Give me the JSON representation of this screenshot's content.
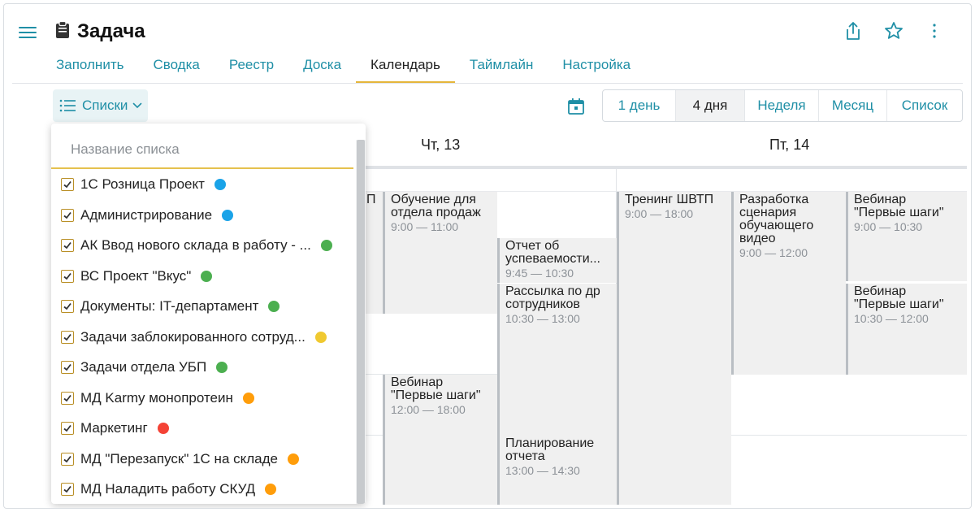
{
  "header": {
    "title": "Задача",
    "icons": [
      "menu-icon",
      "clipboard-icon",
      "share-icon",
      "star-icon",
      "more-vert-icon"
    ]
  },
  "tabs": [
    {
      "label": "Заполнить"
    },
    {
      "label": "Сводка"
    },
    {
      "label": "Реестр"
    },
    {
      "label": "Доска"
    },
    {
      "label": "Календарь",
      "active": true
    },
    {
      "label": "Таймлайн"
    },
    {
      "label": "Настройка"
    }
  ],
  "toolbar": {
    "lists_label": "Списки",
    "view_buttons": [
      "1 день",
      "4 дня",
      "Неделя",
      "Месяц",
      "Список"
    ],
    "active_view": "4 дня"
  },
  "calendar": {
    "days": [
      "Чт, 13",
      "Пт, 14"
    ],
    "events": [
      {
        "title": "П",
        "time": ""
      },
      {
        "title": "Обучение для\nотдела продаж",
        "time": "9:00 — 11:00"
      },
      {
        "title": "Отчет об\nуспеваемости...",
        "time": "9:45 — 10:30"
      },
      {
        "title": "Рассылка по др\nсотрудников",
        "time": "10:30 — 13:00"
      },
      {
        "title": "Вебинар\n\"Первые шаги\"",
        "time": "12:00 — 18:00"
      },
      {
        "title": "Планирование\nотчета",
        "time": "13:00 — 14:30"
      },
      {
        "title": "Тренинг ШВТП",
        "time": "9:00 — 18:00"
      },
      {
        "title": "Разработка\nсценария\nобучающего\nвидео",
        "time": "9:00 — 12:00"
      },
      {
        "title": "Вебинар\n\"Первые шаги\"",
        "time": "9:00 — 10:30"
      },
      {
        "title": "Вебинар\n\"Первые шаги\"",
        "time": "10:30 — 12:00"
      }
    ]
  },
  "lists_dropdown": {
    "search_placeholder": "Название списка",
    "items": [
      {
        "label": "1С Розница Проект",
        "color": "#1aa3e8",
        "checked": true
      },
      {
        "label": "Администрирование",
        "color": "#1aa3e8",
        "checked": true
      },
      {
        "label": "АК Ввод нового склада в работу - ...",
        "color": "#4caf50",
        "checked": true
      },
      {
        "label": "ВС Проект \"Вкус\"",
        "color": "#4caf50",
        "checked": true
      },
      {
        "label": "Документы: IT-департамент",
        "color": "#4caf50",
        "checked": true
      },
      {
        "label": "Задачи заблокированного сотруд...",
        "color": "#f0c930",
        "checked": true
      },
      {
        "label": "Задачи отдела УБП",
        "color": "#4caf50",
        "checked": true
      },
      {
        "label": "МД Karmy монопротеин",
        "color": "#ff9d0a",
        "checked": true
      },
      {
        "label": "Маркетинг",
        "color": "#f44336",
        "checked": true
      },
      {
        "label": "МД \"Перезапуск\" 1С на складе",
        "color": "#ff9d0a",
        "checked": true
      },
      {
        "label": "МД Наладить работу СКУД",
        "color": "#ff9d0a",
        "checked": true
      }
    ]
  }
}
